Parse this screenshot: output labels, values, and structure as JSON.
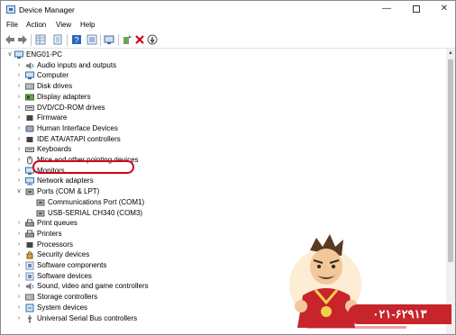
{
  "window": {
    "title": "Device Manager"
  },
  "menubar": {
    "file": "File",
    "action": "Action",
    "view": "View",
    "help": "Help"
  },
  "tree": {
    "root": "ENG01-PC",
    "items": [
      {
        "label": "Audio inputs and outputs",
        "icon": "speaker-icon",
        "expanded": false
      },
      {
        "label": "Computer",
        "icon": "computer-icon",
        "expanded": false
      },
      {
        "label": "Disk drives",
        "icon": "disk-icon",
        "expanded": false
      },
      {
        "label": "Display adapters",
        "icon": "display-adapter-icon",
        "expanded": false
      },
      {
        "label": "DVD/CD-ROM drives",
        "icon": "dvd-icon",
        "expanded": false
      },
      {
        "label": "Firmware",
        "icon": "firmware-icon",
        "expanded": false
      },
      {
        "label": "Human Interface Devices",
        "icon": "hid-icon",
        "expanded": false
      },
      {
        "label": "IDE ATA/ATAPI controllers",
        "icon": "ide-icon",
        "expanded": false
      },
      {
        "label": "Keyboards",
        "icon": "keyboard-icon",
        "expanded": false
      },
      {
        "label": "Mice and other pointing devices",
        "icon": "mouse-icon",
        "expanded": false
      },
      {
        "label": "Monitors",
        "icon": "monitor-icon",
        "expanded": false
      },
      {
        "label": "Network adapters",
        "icon": "network-icon",
        "expanded": false
      },
      {
        "label": "Ports (COM & LPT)",
        "icon": "port-icon",
        "expanded": true,
        "children": [
          {
            "label": "Communications Port (COM1)",
            "icon": "port-icon"
          },
          {
            "label": "USB-SERIAL CH340 (COM3)",
            "icon": "port-icon"
          }
        ]
      },
      {
        "label": "Print queues",
        "icon": "printer-icon",
        "expanded": false
      },
      {
        "label": "Printers",
        "icon": "printer-icon",
        "expanded": false
      },
      {
        "label": "Processors",
        "icon": "processor-icon",
        "expanded": false
      },
      {
        "label": "Security devices",
        "icon": "security-icon",
        "expanded": false
      },
      {
        "label": "Software components",
        "icon": "software-icon",
        "expanded": false
      },
      {
        "label": "Software devices",
        "icon": "software-icon",
        "expanded": false
      },
      {
        "label": "Sound, video and game controllers",
        "icon": "speaker-icon",
        "expanded": false
      },
      {
        "label": "Storage controllers",
        "icon": "storage-icon",
        "expanded": false
      },
      {
        "label": "System devices",
        "icon": "system-icon",
        "expanded": false
      },
      {
        "label": "Universal Serial Bus controllers",
        "icon": "usb-icon",
        "expanded": false
      }
    ]
  },
  "watermark": {
    "phone": "۰۲۱-۶۲۹۱۳"
  },
  "colors": {
    "highlight": "#d0021b",
    "banner": "#c8242c",
    "icon_blue": "#3a6ea5"
  }
}
